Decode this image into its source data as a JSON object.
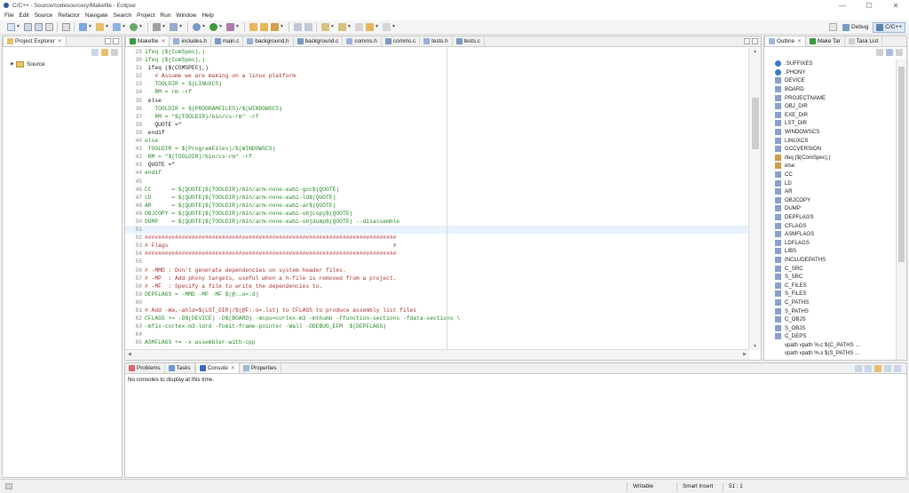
{
  "window": {
    "title": "C/C++ - Source/codesourcery/Makefile - Eclipse",
    "minimize": "—",
    "maximize": "☐",
    "close": "✕"
  },
  "menu": [
    "File",
    "Edit",
    "Source",
    "Refactor",
    "Navigate",
    "Search",
    "Project",
    "Run",
    "Window",
    "Help"
  ],
  "perspectives": {
    "debug_label": "Debug",
    "cpp_label": "C/C++"
  },
  "project_explorer": {
    "tab_label": "Project Explorer",
    "tree": [
      {
        "label": "Source",
        "expanded": false
      }
    ]
  },
  "editor": {
    "tabs": [
      {
        "label": "Makefile",
        "active": true
      },
      {
        "label": "includes.h"
      },
      {
        "label": "main.c"
      },
      {
        "label": "background.h"
      },
      {
        "label": "background.c"
      },
      {
        "label": "comms.h"
      },
      {
        "label": "comms.c"
      },
      {
        "label": "tests.h"
      },
      {
        "label": "tests.c"
      }
    ],
    "lines": [
      {
        "n": "29",
        "t": "ifeq ($(ComSpec),)",
        "c": "c-var"
      },
      {
        "n": "30",
        "t": "ifeq ($(ComSpec),)",
        "c": "c-var"
      },
      {
        "n": "31",
        "t": " ifeq ($(COMSPEC),)",
        "c": "c-def"
      },
      {
        "n": "32",
        "t": "   # Assume we are making on a linux platform",
        "c": "c-com"
      },
      {
        "n": "33",
        "t": "   TOOLDIR = $(LINUXCS)",
        "c": "c-var"
      },
      {
        "n": "34",
        "t": "   RM = rm -rf",
        "c": "c-var"
      },
      {
        "n": "35",
        "t": " else",
        "c": "c-def"
      },
      {
        "n": "36",
        "t": "   TOOLDIR = $(PROGRAMFILES)/$(WINDOWSCS)",
        "c": "c-var"
      },
      {
        "n": "37",
        "t": "   RM = \"$(TOOLDIR)/bin/cs-rm\" -rf",
        "c": "c-var"
      },
      {
        "n": "38",
        "t": "   QUOTE =\"",
        "c": "c-def"
      },
      {
        "n": "39",
        "t": " endif",
        "c": "c-def"
      },
      {
        "n": "40",
        "t": "else",
        "c": "c-var"
      },
      {
        "n": "41",
        "t": " TOOLDIR = $(ProgramFiles)/$(WINDOWSCS)",
        "c": "c-var"
      },
      {
        "n": "42",
        "t": " RM = \"$(TOOLDIR)/bin/cs-rm\" -rf",
        "c": "c-var"
      },
      {
        "n": "43",
        "t": " QUOTE =\"",
        "c": "c-def"
      },
      {
        "n": "44",
        "t": "endif",
        "c": "c-var"
      },
      {
        "n": "45",
        "t": "",
        "c": "c-def"
      },
      {
        "n": "46",
        "t": "CC      = $(QUOTE)$(TOOLDIR)/bin/arm-none-eabi-gcc$(QUOTE)",
        "c": "c-var"
      },
      {
        "n": "47",
        "t": "LD      = $(QUOTE)$(TOOLDIR)/bin/arm-none-eabi-ld$(QUOTE)",
        "c": "c-var"
      },
      {
        "n": "48",
        "t": "AR      = $(QUOTE)$(TOOLDIR)/bin/arm-none-eabi-ar$(QUOTE)",
        "c": "c-var"
      },
      {
        "n": "49",
        "t": "OBJCOPY = $(QUOTE)$(TOOLDIR)/bin/arm-none-eabi-objcopy$(QUOTE)",
        "c": "c-var"
      },
      {
        "n": "50",
        "t": "DUMP    = $(QUOTE)$(TOOLDIR)/bin/arm-none-eabi-objdump$(QUOTE) --disassemble",
        "c": "c-var"
      },
      {
        "n": "51",
        "t": "",
        "c": "c-def",
        "hl": true
      },
      {
        "n": "52",
        "t": "###########################################################################",
        "c": "c-com"
      },
      {
        "n": "53",
        "t": "# Flags                                                                   #",
        "c": "c-com"
      },
      {
        "n": "54",
        "t": "###########################################################################",
        "c": "c-com"
      },
      {
        "n": "55",
        "t": "",
        "c": "c-def"
      },
      {
        "n": "56",
        "t": "# -MMD : Don't generate dependencies on system header files.",
        "c": "c-com"
      },
      {
        "n": "57",
        "t": "# -MP  : Add phony targets, useful when a h-file is removed from a project.",
        "c": "c-com"
      },
      {
        "n": "58",
        "t": "# -MF  : Specify a file to write the dependencies to.",
        "c": "c-com"
      },
      {
        "n": "59",
        "t": "DEPFLAGS = -MMD -MP -MF $(@:.o=.d)",
        "c": "c-var"
      },
      {
        "n": "60",
        "t": "",
        "c": "c-def"
      },
      {
        "n": "61",
        "t": "# Add -Wa,-ahld=$(LST_DIR)/$(@F:.o=.lst) to CFLAGS to produce assembly list files",
        "c": "c-com"
      },
      {
        "n": "62",
        "t": "CFLAGS += -D$(DEVICE) -D$(BOARD) -mcpu=cortex-m3 -mthumb -ffunction-sections -fdata-sections \\",
        "c": "c-var"
      },
      {
        "n": "63",
        "t": "-mfix-cortex-m3-ldrd -fomit-frame-pointer -Wall -DDEBUG_EFM  $(DEPFLAGS)",
        "c": "c-var"
      },
      {
        "n": "64",
        "t": "",
        "c": "c-def"
      },
      {
        "n": "65",
        "t": "ASMFLAGS += -x assembler-with-cpp",
        "c": "c-var"
      }
    ]
  },
  "outline": {
    "tabs": [
      {
        "label": "Outline",
        "active": true
      },
      {
        "label": "Make Tar"
      },
      {
        "label": "Task List"
      }
    ],
    "items": [
      {
        "label": ".SUFFIXES",
        "kind": "target"
      },
      {
        "label": ".PHONY",
        "kind": "target"
      },
      {
        "label": "DEVICE",
        "kind": "var"
      },
      {
        "label": "BOARD",
        "kind": "var"
      },
      {
        "label": "PROJECTNAME",
        "kind": "var"
      },
      {
        "label": "OBJ_DIR",
        "kind": "var"
      },
      {
        "label": "EXE_DIR",
        "kind": "var"
      },
      {
        "label": "LST_DIR",
        "kind": "var"
      },
      {
        "label": "WINDOWSCS",
        "kind": "var"
      },
      {
        "label": "LINUXCS",
        "kind": "var"
      },
      {
        "label": "GCCVERSION",
        "kind": "var"
      },
      {
        "label": "ifeq ($(ComSpec),)",
        "kind": "cond"
      },
      {
        "label": "else",
        "kind": "cond"
      },
      {
        "label": "CC",
        "kind": "var"
      },
      {
        "label": "LD",
        "kind": "var"
      },
      {
        "label": "AR",
        "kind": "var"
      },
      {
        "label": "OBJCOPY",
        "kind": "var"
      },
      {
        "label": "DUMP",
        "kind": "var"
      },
      {
        "label": "DEPFLAGS",
        "kind": "var"
      },
      {
        "label": "CFLAGS",
        "kind": "var"
      },
      {
        "label": "ASMFLAGS",
        "kind": "var"
      },
      {
        "label": "LDFLAGS",
        "kind": "var"
      },
      {
        "label": "LIBS",
        "kind": "var"
      },
      {
        "label": "INCLUDEPATHS",
        "kind": "var"
      },
      {
        "label": "C_SRC",
        "kind": "var"
      },
      {
        "label": "S_SRC",
        "kind": "var"
      },
      {
        "label": "C_FILES",
        "kind": "var"
      },
      {
        "label": "S_FILES",
        "kind": "var"
      },
      {
        "label": "C_PATHS",
        "kind": "var"
      },
      {
        "label": "S_PATHS",
        "kind": "var"
      },
      {
        "label": "C_OBJS",
        "kind": "var"
      },
      {
        "label": "S_OBJS",
        "kind": "var"
      },
      {
        "label": "C_DEPS",
        "kind": "var"
      },
      {
        "label": "vpath vpath %.c $(C_PATHS ...",
        "kind": "none"
      },
      {
        "label": "vpath vpath %.s $(S_PATHS ...",
        "kind": "none"
      }
    ]
  },
  "console": {
    "tabs": [
      {
        "label": "Problems"
      },
      {
        "label": "Tasks"
      },
      {
        "label": "Console",
        "active": true
      },
      {
        "label": "Properties"
      }
    ],
    "message": "No consoles to display at this time."
  },
  "status": {
    "writable": "Writable",
    "insert_mode": "Smart Insert",
    "position": "51 : 1"
  },
  "colors": {
    "accent": "#2c5aa0",
    "active_tab_bg": "#ffffff",
    "highlight_line": "#e8f2fe"
  }
}
